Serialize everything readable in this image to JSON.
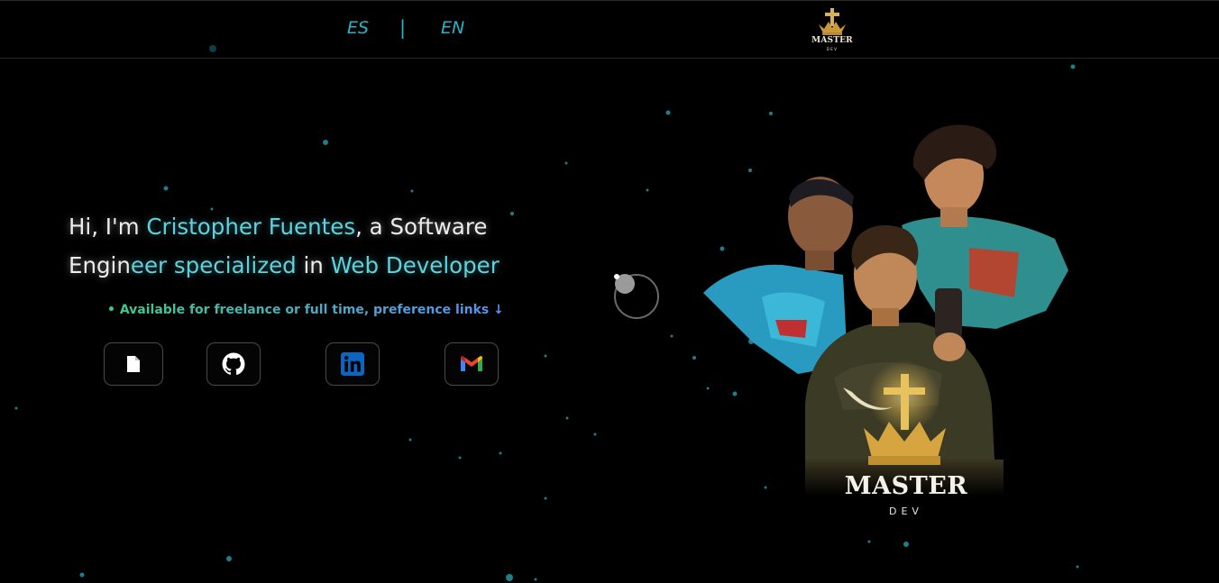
{
  "header": {
    "lang_es": "ES",
    "lang_separator": "|",
    "lang_en": "EN",
    "logo_word": "MASTER",
    "logo_sub": "DEV"
  },
  "hero": {
    "intro_prefix": "Hi, I'm ",
    "name": "Cristopher Fuentes",
    "intro_middle": ", a Software Engin",
    "role_gradient_tail": "eer specialized",
    "intro_suffix": " in ",
    "specialty": "Web Developer",
    "availability": "• Available for freelance or full time, preference links ↓"
  },
  "social_links": [
    {
      "name": "cv-document",
      "icon": "document-icon"
    },
    {
      "name": "github",
      "icon": "github-icon"
    },
    {
      "name": "linkedin",
      "icon": "linkedin-icon"
    },
    {
      "name": "gmail",
      "icon": "gmail-icon"
    }
  ],
  "artwork": {
    "brand_word": "MASTER",
    "brand_sub": "DEV"
  },
  "colors": {
    "background": "#000000",
    "accent_cyan": "#21b6c9",
    "name_cyan": "#5fd3dd",
    "availability_green": "#3fc98c",
    "availability_blue": "#5a8ef0",
    "linkedin_blue": "#0a66c2"
  }
}
